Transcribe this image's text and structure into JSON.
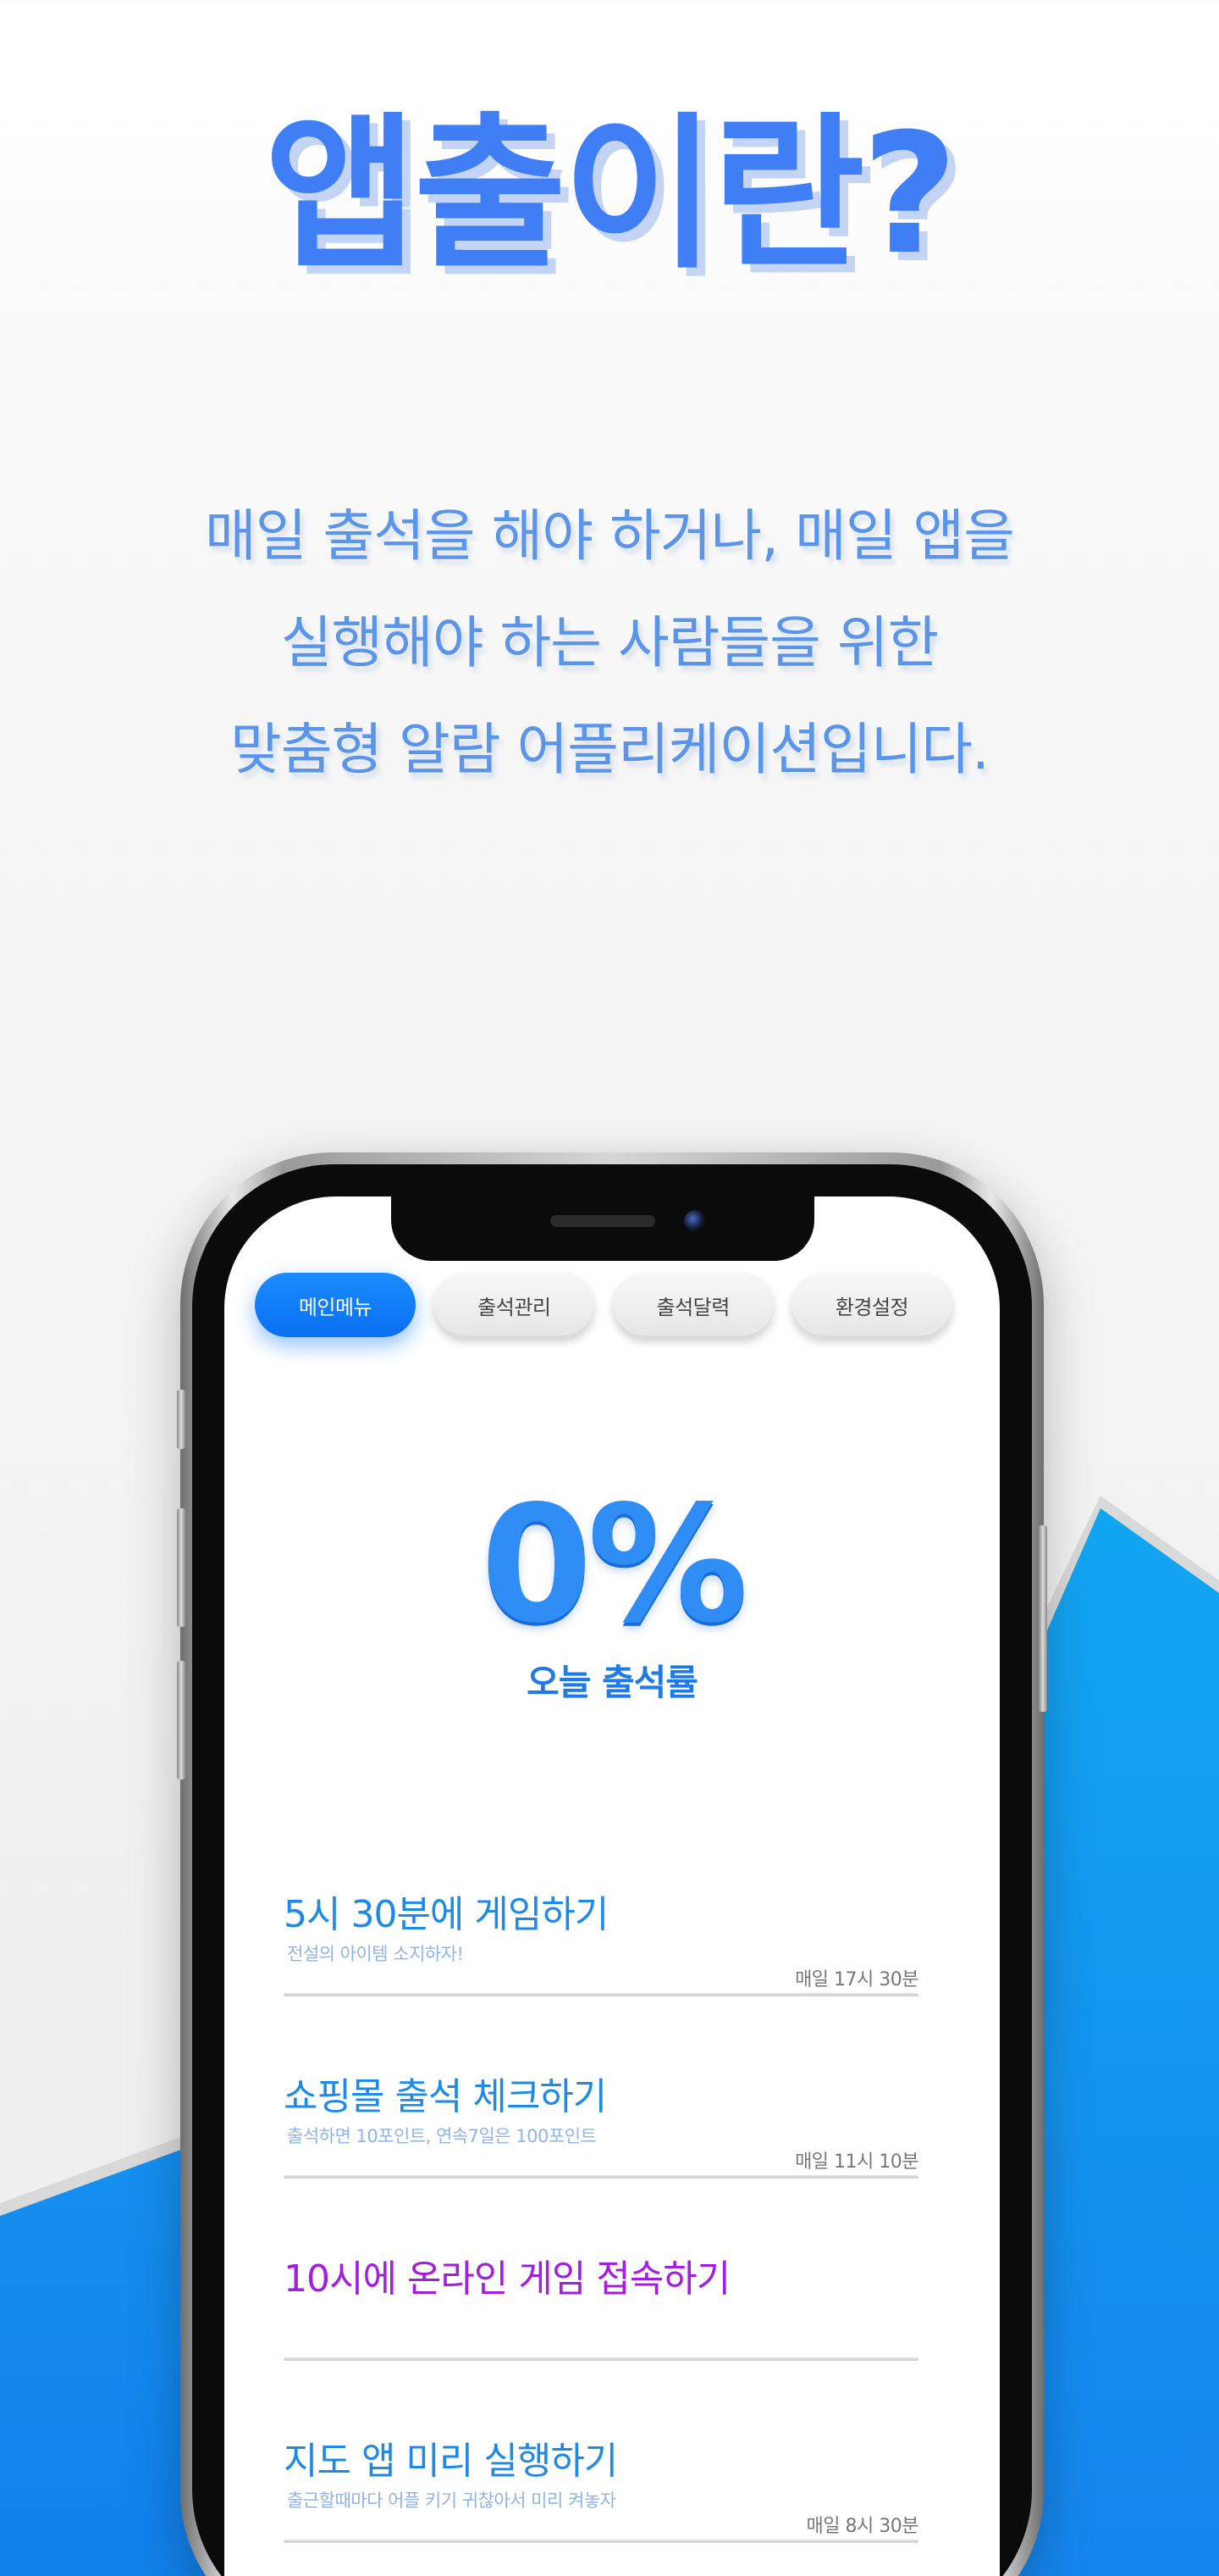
{
  "hero": {
    "title": "앱출이란?",
    "description_lines": [
      "매일 출석을 해야 하거나, 매일 앱을",
      "실행해야 하는 사람들을 위한",
      "맞춤형 알람 어플리케이션입니다."
    ]
  },
  "tabs": [
    {
      "label": "메인메뉴",
      "active": true
    },
    {
      "label": "출석관리",
      "active": false
    },
    {
      "label": "출석달력",
      "active": false
    },
    {
      "label": "환경설정",
      "active": false
    }
  ],
  "attendance": {
    "rate": "0%",
    "label": "오늘 출석률"
  },
  "alarms": [
    {
      "title": "5시 30분에 게임하기",
      "subtitle": "전설의 아이템 소지하자!",
      "time": "매일 17시 30분"
    },
    {
      "title": "쇼핑몰 출석 체크하기",
      "subtitle": "출석하면 10포인트, 연속7일은 100포인트",
      "time": "매일 11시 10분"
    },
    {
      "title": "10시에 온라인 게임 접속하기",
      "subtitle": "",
      "time": ""
    },
    {
      "title": "지도 앱 미리 실행하기",
      "subtitle": "출근할때마다 어플 키기 귀찮아서 미리 켜놓자",
      "time": "매일 8시 30분"
    }
  ],
  "colors": {
    "accent_blue": "#1a8cff",
    "title_blue": "#3f7ef5",
    "purple": "#a21ee0",
    "bg_blue": "#1090f0"
  }
}
